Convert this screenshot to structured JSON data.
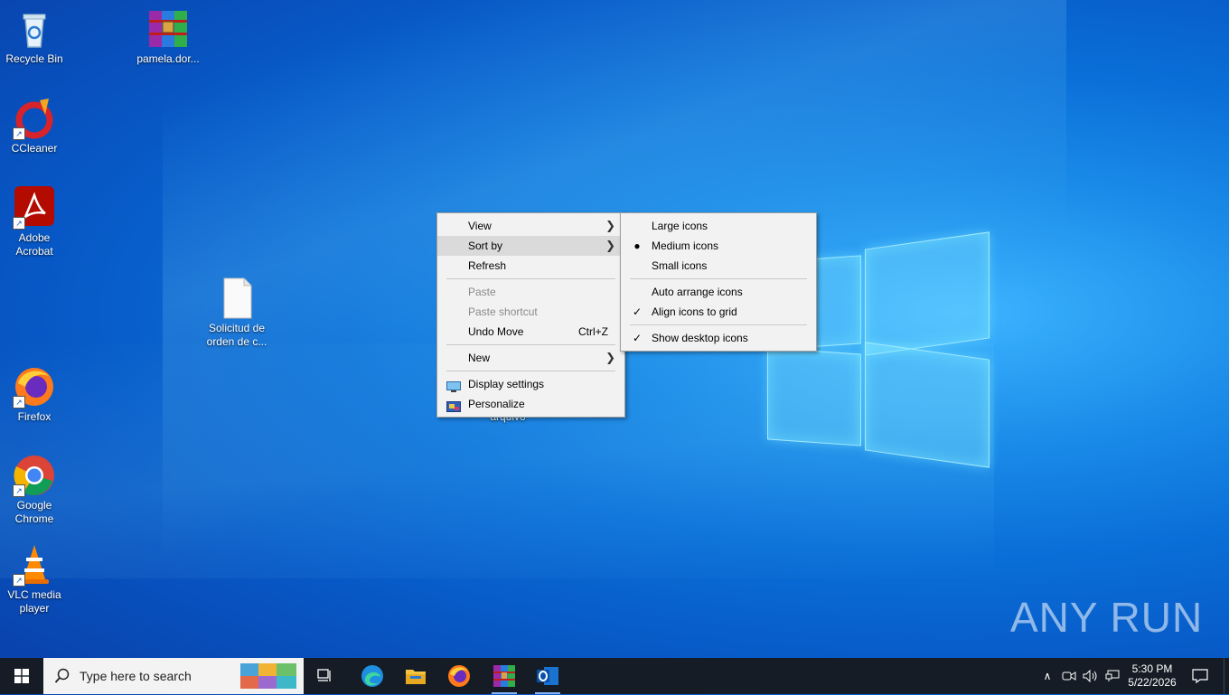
{
  "desktop": {
    "icons": [
      {
        "label": "Recycle Bin"
      },
      {
        "label": "pamela.dor..."
      },
      {
        "label": "CCleaner"
      },
      {
        "label": "Adobe Acrobat"
      },
      {
        "label": "Solicitud de orden de c..."
      },
      {
        "label": "Firefox"
      },
      {
        "label": "Google Chrome"
      },
      {
        "label": "VLC media player"
      }
    ],
    "hidden_label": "arquivo"
  },
  "context_menu": {
    "view": "View",
    "sort_by": "Sort by",
    "refresh": "Refresh",
    "paste": "Paste",
    "paste_shortcut": "Paste shortcut",
    "undo_move": "Undo Move",
    "undo_shortcut": "Ctrl+Z",
    "new": "New",
    "display_settings": "Display settings",
    "personalize": "Personalize"
  },
  "view_submenu": {
    "large_icons": "Large icons",
    "medium_icons": "Medium icons",
    "small_icons": "Small icons",
    "auto_arrange": "Auto arrange icons",
    "align_grid": "Align icons to grid",
    "show_desktop_icons": "Show desktop icons",
    "selected_size": "Medium icons",
    "checked": [
      "Align icons to grid",
      "Show desktop icons"
    ]
  },
  "taskbar": {
    "search_placeholder": "Type here to search",
    "pinned_apps": [
      "task-view",
      "edge",
      "file-explorer",
      "firefox",
      "winrar",
      "outlook"
    ],
    "clock_time": "5:30 PM",
    "clock_date": "5/22/2026"
  },
  "watermark": "ANY RUN",
  "colors": {
    "desktop_blue": "#0a6fd8",
    "taskbar": "#151c26",
    "menu_bg": "#f2f2f2",
    "menu_highlight": "#dadada"
  }
}
